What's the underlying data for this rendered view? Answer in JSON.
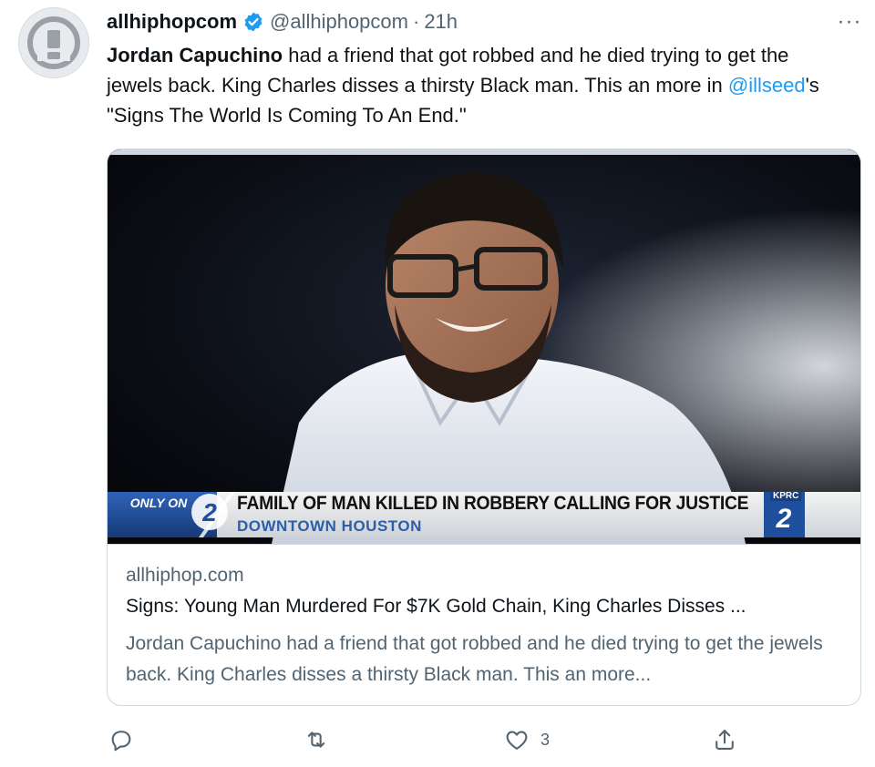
{
  "tweet": {
    "display_name": "allhiphopcom",
    "handle": "@allhiphopcom",
    "separator": "·",
    "time": "21h",
    "more_label": "···",
    "text": {
      "part1_bold": "Jordan Capuchino",
      "part2": " had a friend that got robbed and he died trying to get the jewels back. King Charles disses a thirsty Black man. This an more in ",
      "mention": "@illseed",
      "part3": "'s \"Signs The World Is Coming To An End.\""
    }
  },
  "card": {
    "media": {
      "lower_third_badge": "ONLY ON",
      "headline": "FAMILY OF MAN KILLED IN ROBBERY CALLING FOR JUSTICE",
      "location": "DOWNTOWN HOUSTON",
      "station": "KPRC"
    },
    "domain": "allhiphop.com",
    "title": "Signs: Young Man Murdered For $7K Gold Chain, King Charles Disses ...",
    "description": "Jordan Capuchino had a friend that got robbed and he died trying to get the jewels back. King Charles disses a thirsty Black man. This an more..."
  },
  "actions": {
    "reply_icon": "reply-icon",
    "retweet_icon": "retweet-icon",
    "like_icon": "like-icon",
    "like_count": "3",
    "share_icon": "share-icon"
  },
  "colors": {
    "accent": "#1d9bf0",
    "secondary_text": "#536471",
    "border": "#cfd9de"
  }
}
